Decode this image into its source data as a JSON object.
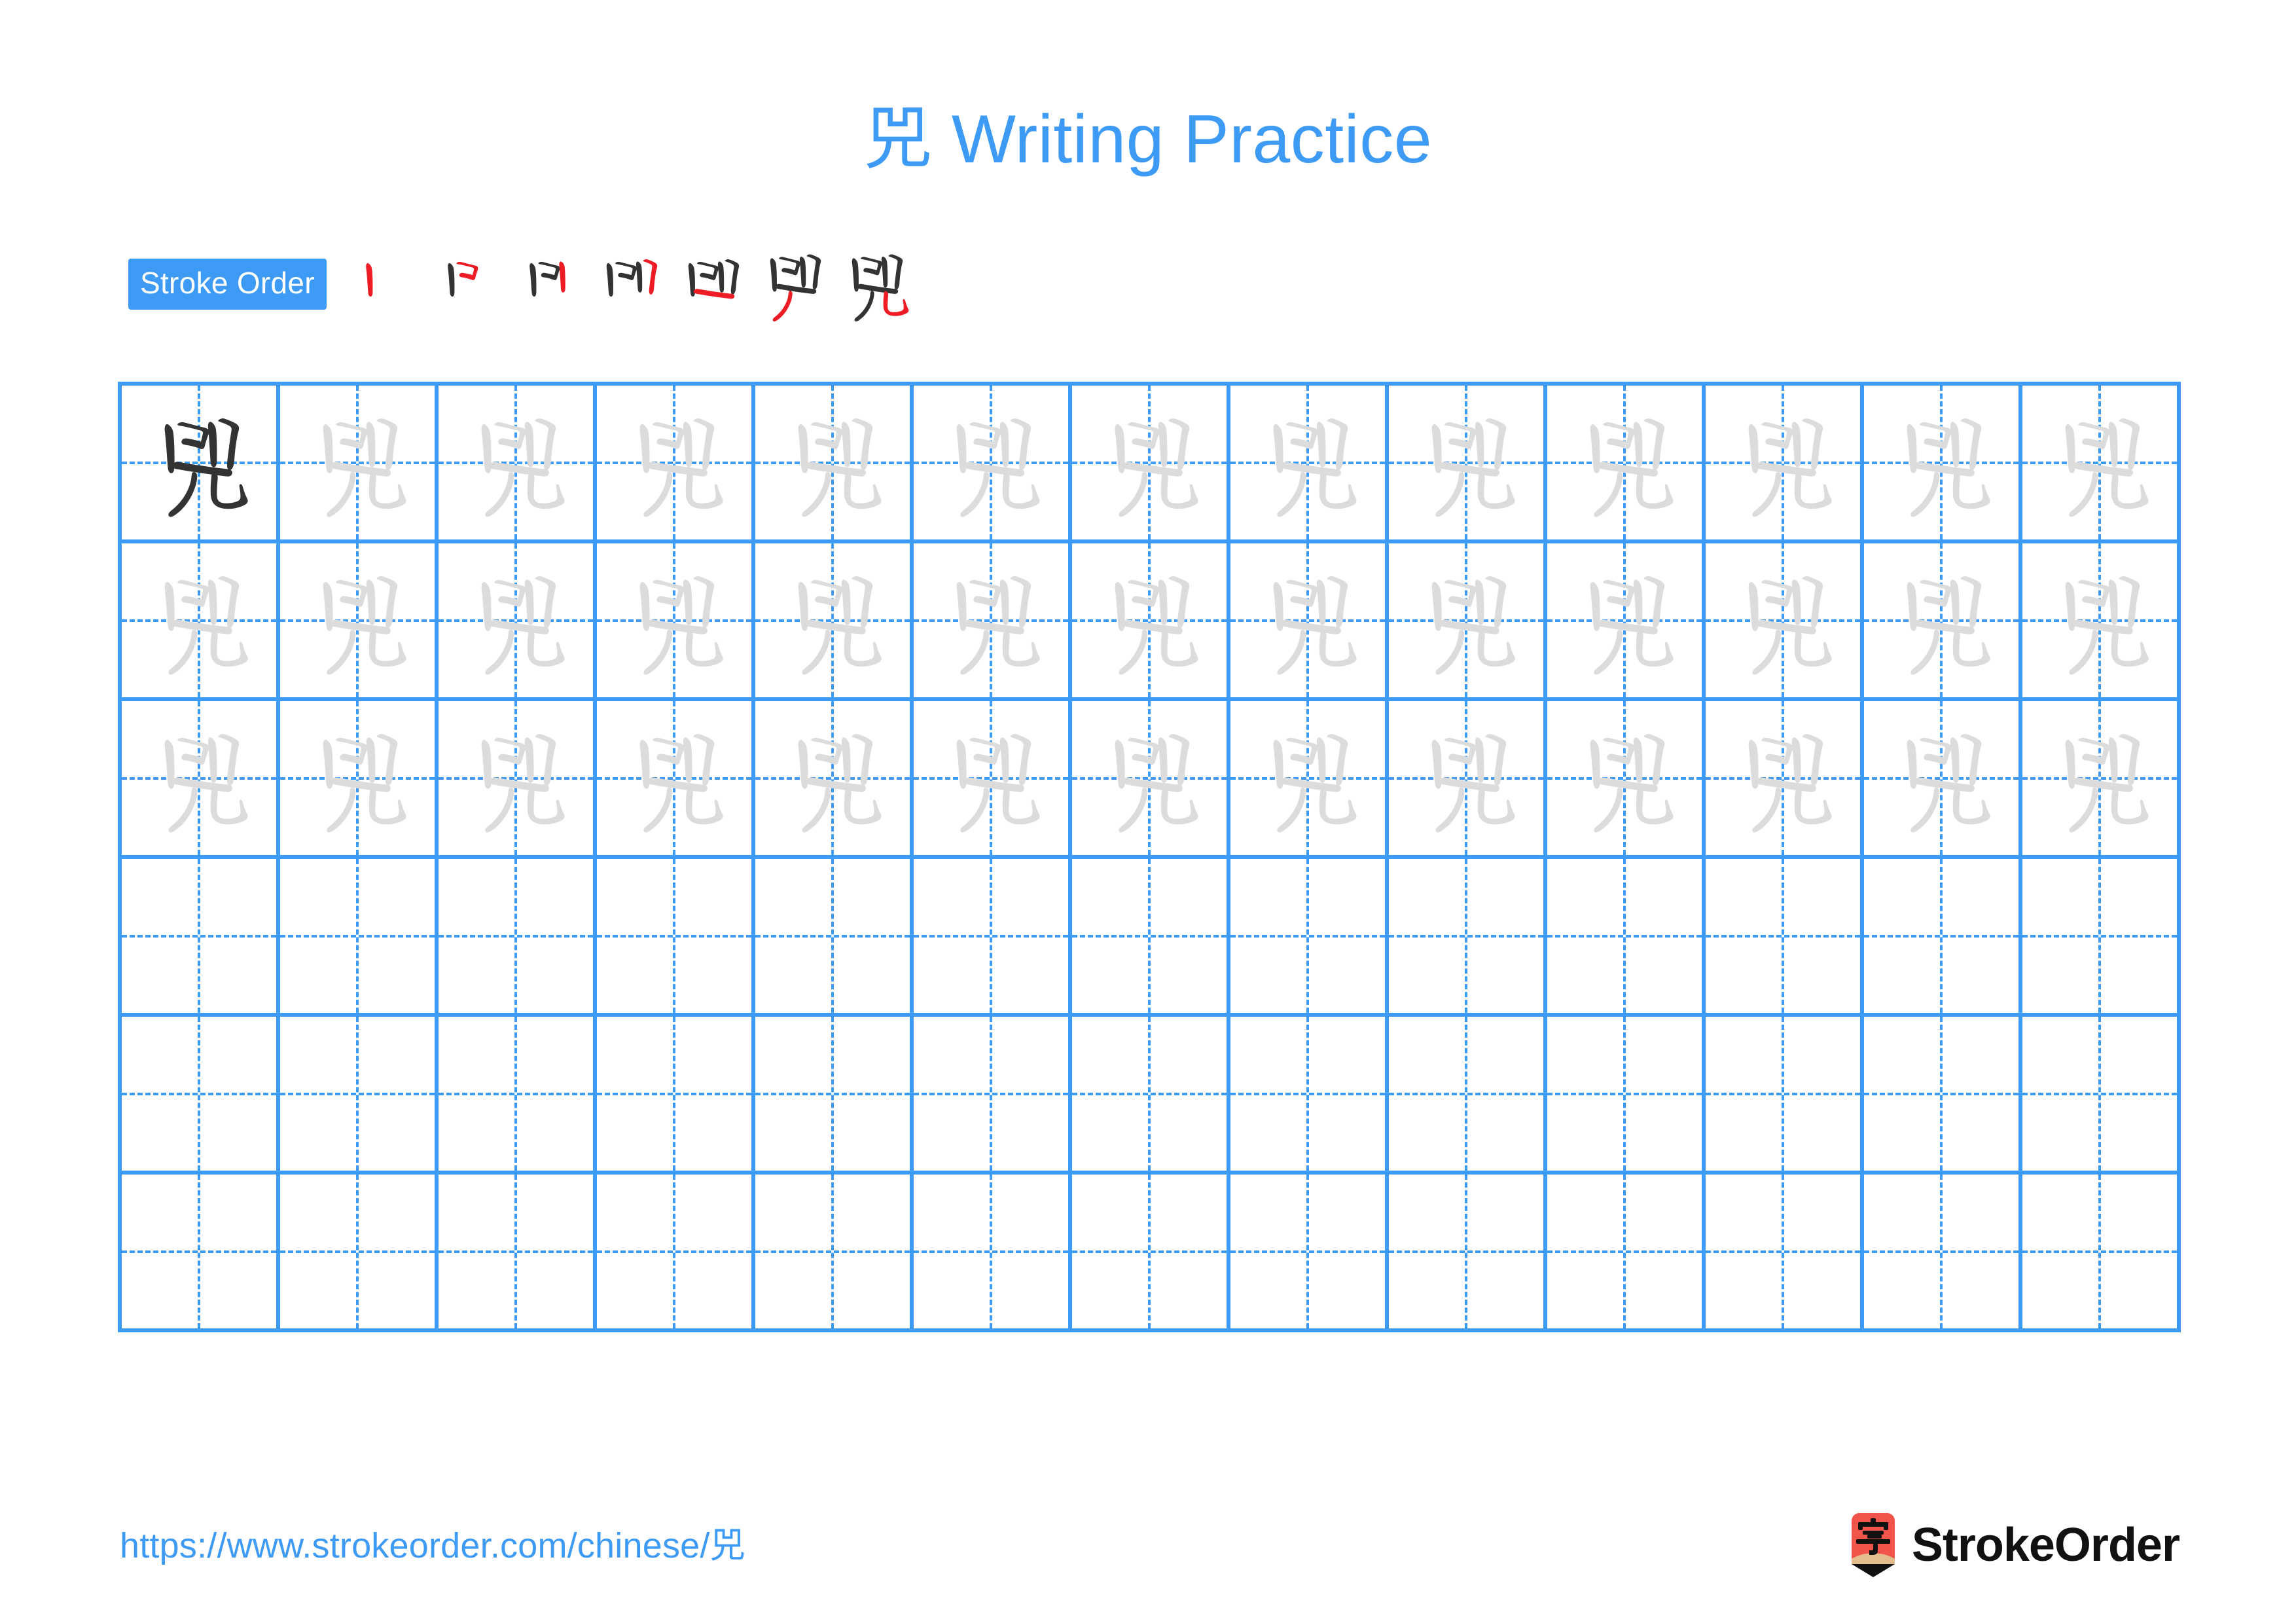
{
  "page": {
    "character": "兕",
    "title_suffix": " Writing Practice",
    "background_color": "#ffffff",
    "accent_color": "#3d9bf5",
    "dark_glyph_color": "#333333",
    "light_glyph_color": "#dcdcdc",
    "stroke_highlight_color": "#ee1c25"
  },
  "stroke_order": {
    "badge_label": "Stroke Order",
    "stroke_count": 7,
    "steps": [
      {
        "index": 1,
        "label": "stroke-step-1"
      },
      {
        "index": 2,
        "label": "stroke-step-2"
      },
      {
        "index": 3,
        "label": "stroke-step-3"
      },
      {
        "index": 4,
        "label": "stroke-step-4"
      },
      {
        "index": 5,
        "label": "stroke-step-5"
      },
      {
        "index": 6,
        "label": "stroke-step-6"
      },
      {
        "index": 7,
        "label": "stroke-step-7"
      }
    ]
  },
  "practice_grid": {
    "columns": 13,
    "rows": 6,
    "filled_rows": 3,
    "first_cell_style": "dark",
    "other_cell_style": "light",
    "cell_character": "兕"
  },
  "footer": {
    "url": "https://www.strokeorder.com/chinese/兕",
    "brand_name": "StrokeOrder",
    "brand_mark_character": "字",
    "brand_mark_color": "#f1544a",
    "brand_mark_wood_color": "#e3bd8e"
  }
}
